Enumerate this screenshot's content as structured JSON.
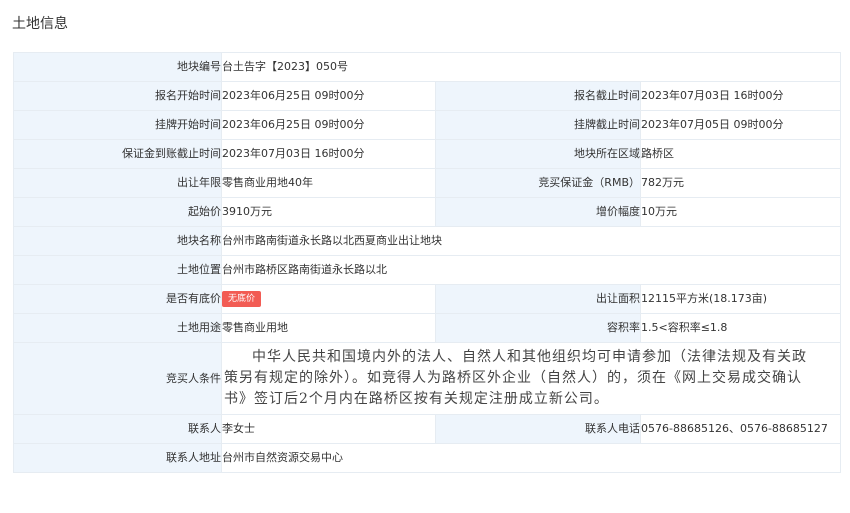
{
  "title": "土地信息",
  "rows": {
    "r1": {
      "l1": "地块编号",
      "v1": "台土告字【2023】050号"
    },
    "r2": {
      "l1": "报名开始时间",
      "v1": "2023年06月25日 09时00分",
      "l2": "报名截止时间",
      "v2": "2023年07月03日 16时00分"
    },
    "r3": {
      "l1": "挂牌开始时间",
      "v1": "2023年06月25日 09时00分",
      "l2": "挂牌截止时间",
      "v2": "2023年07月05日 09时00分"
    },
    "r4": {
      "l1": "保证金到账截止时间",
      "v1": "2023年07月03日 16时00分",
      "l2": "地块所在区域",
      "v2": "路桥区"
    },
    "r5": {
      "l1": "出让年限",
      "v1": "零售商业用地40年",
      "l2": "竞买保证金（RMB）",
      "v2": "782万元"
    },
    "r6": {
      "l1": "起始价",
      "v1": "3910万元",
      "l2": "增价幅度",
      "v2": "10万元"
    },
    "r7": {
      "l1": "地块名称",
      "v1": "台州市路南街道永长路以北西夏商业出让地块"
    },
    "r8": {
      "l1": "土地位置",
      "v1": "台州市路桥区路南街道永长路以北"
    },
    "r9": {
      "l1": "是否有底价",
      "badge": "无底价",
      "l2": "出让面积",
      "v2": "12115平方米(18.173亩)"
    },
    "r10": {
      "l1": "土地用途",
      "v1": "零售商业用地",
      "l2": "容积率",
      "v2": "1.5<容积率≤1.8"
    },
    "r11": {
      "l1": "竞买人条件",
      "v1": "中华人民共和国境内外的法人、自然人和其他组织均可申请参加（法律法规及有关政策另有规定的除外）。如竞得人为路桥区外企业（自然人）的，须在《网上交易成交确认书》签订后2个月内在路桥区按有关规定注册成立新公司。"
    },
    "r12": {
      "l1": "联系人",
      "v1": "李女士",
      "l2": "联系人电话",
      "v2": "0576-88685126、0576-88685127"
    },
    "r13": {
      "l1": "联系人地址",
      "v1": "台州市自然资源交易中心"
    }
  },
  "colors": {
    "label_bg": "#eef5fc",
    "border": "#e6ecf2",
    "badge_bg": "#f25c54"
  }
}
